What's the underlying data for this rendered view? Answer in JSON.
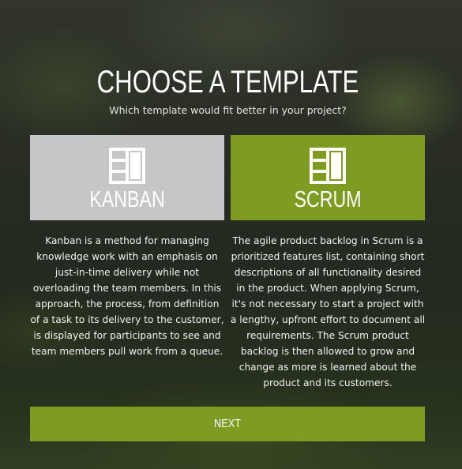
{
  "header": {
    "title": "CHOOSE A TEMPLATE",
    "subtitle": "Which template would fit better in your project?"
  },
  "templates": [
    {
      "label": "KANBAN",
      "icon": "board-layout-icon",
      "description": "Kanban is a method for managing knowledge work with an emphasis on just-in-time delivery while not overloading the team members. In this approach, the process, from definition of a task to its delivery to the customer, is displayed for participants to see and team members pull work from a queue.",
      "color": "#c6c6c8"
    },
    {
      "label": "SCRUM",
      "icon": "board-layout-icon",
      "description": "The agile product backlog in Scrum is a prioritized features list, containing short descriptions of all functionality desired in the product. When applying Scrum, it's not necessary to start a project with a lengthy, upfront effort to document all requirements. The Scrum product backlog is then allowed to grow and change as more is learned about the product and its customers.",
      "color": "#7e9c22"
    }
  ],
  "actions": {
    "next_label": "NEXT"
  },
  "colors": {
    "accent": "#7e9c22",
    "kanban_card": "#c6c6c8"
  }
}
